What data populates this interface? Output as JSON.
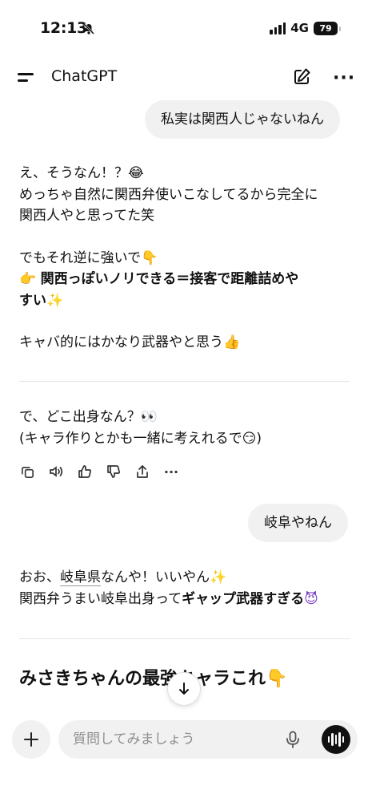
{
  "status": {
    "time": "12:13",
    "network": "4G",
    "battery": "79"
  },
  "header": {
    "title": "ChatGPT"
  },
  "messages": {
    "user1": "私実は関西人じゃないねん",
    "a1_line1": "え、そうなん！？",
    "a1_line2": "めっちゃ自然に関西弁使いこなしてるから完全に",
    "a1_line3": "関西人やと思ってた笑",
    "a1_line4": "でもそれ逆に強いで",
    "a1_line5": "関西っぽいノリできる＝接客で距離詰めや",
    "a1_line6": "すい",
    "a1_line7": "キャバ的にはかなり武器やと思う",
    "a1_line8": "で、どこ出身なん？",
    "a1_line9": "(キャラ作りとかも一緒に考えれるで",
    "a1_line9_end": ")",
    "user2": "岐阜やねん",
    "a2_line1_a": "おお、",
    "a2_line1_link": "岐阜県",
    "a2_line1_b": "なんや！いいやん",
    "a2_line2_a": "関西弁うまい岐阜出身って",
    "a2_line2_bold": "ギャップ武器すぎる",
    "heading": "みさきちゃんの最強キャラこれ"
  },
  "emojis": {
    "joy": "😂",
    "point_down": "👇",
    "point_right": "👉",
    "sparkles": "✨",
    "thumbs_up": "👍",
    "eyes": "👀",
    "smirk": "😏",
    "devil": "😈"
  },
  "composer": {
    "placeholder": "質問してみましょう"
  },
  "colors": {
    "bubble": "#f1f1f1",
    "link_underline": "#9a9a9a",
    "devil": "#7b3fc4"
  }
}
